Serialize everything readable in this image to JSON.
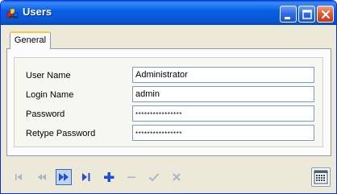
{
  "window": {
    "title": "Users"
  },
  "tabs": [
    {
      "label": "General",
      "active": true
    }
  ],
  "form": {
    "user_name": {
      "label": "User Name",
      "value": "Administrator"
    },
    "login_name": {
      "label": "Login Name",
      "value": "admin"
    },
    "password": {
      "label": "Password",
      "value": "****************"
    },
    "retype_password": {
      "label": "Retype Password",
      "value": "****************"
    }
  },
  "navigator": {
    "buttons": [
      {
        "icon": "first-record-icon",
        "enabled": false
      },
      {
        "icon": "previous-record-icon",
        "enabled": false
      },
      {
        "icon": "next-record-icon",
        "enabled": true,
        "active": true
      },
      {
        "icon": "last-record-icon",
        "enabled": true
      },
      {
        "icon": "add-record-icon",
        "enabled": true
      },
      {
        "icon": "delete-record-icon",
        "enabled": false
      },
      {
        "icon": "post-edit-icon",
        "enabled": false
      },
      {
        "icon": "cancel-edit-icon",
        "enabled": false
      }
    ],
    "extra_icon": "calculator-icon"
  },
  "colors": {
    "titlebar": "#0a56d0",
    "accent_blue": "#1f4fd6",
    "disabled": "#a9b4c8",
    "tab_highlight": "#ffc83c"
  }
}
